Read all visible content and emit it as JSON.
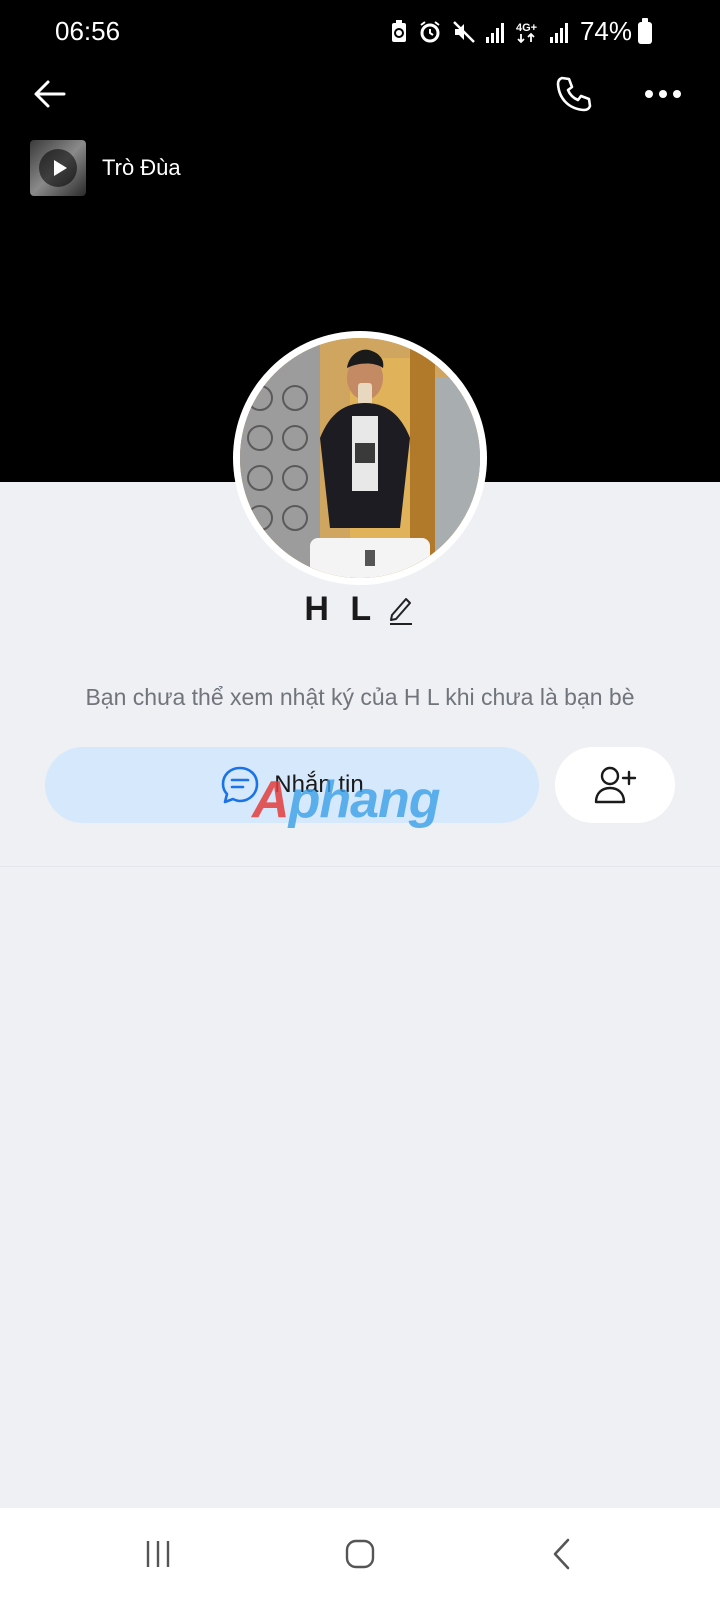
{
  "status_bar": {
    "time": "06:56",
    "battery": "74%",
    "icons": [
      "battery-saver-icon",
      "alarm-icon",
      "mute-icon",
      "signal-icon",
      "4g-plus-icon",
      "signal-icon"
    ]
  },
  "header": {
    "back_icon": "arrow-left-icon",
    "call_icon": "phone-icon",
    "more_icon": "more-horizontal-icon"
  },
  "music": {
    "title": "Trò Đùa",
    "play_icon": "play-icon"
  },
  "profile": {
    "name": "H L",
    "edit_icon": "pencil-icon",
    "info": "Bạn chưa thể xem nhật ký của H L khi chưa là bạn bè"
  },
  "actions": {
    "message_label": "Nhắn tin",
    "message_icon": "chat-bubble-icon",
    "add_friend_icon": "add-user-icon"
  },
  "watermark": {
    "first": "A",
    "rest": "phang"
  },
  "colors": {
    "cover": "#000000",
    "page_bg": "#eef0f3",
    "message_button_bg": "#d6e8fb",
    "accent_blue": "#1a73e8"
  },
  "nav": {
    "icons": [
      "recent-apps-icon",
      "home-icon",
      "back-icon"
    ]
  }
}
